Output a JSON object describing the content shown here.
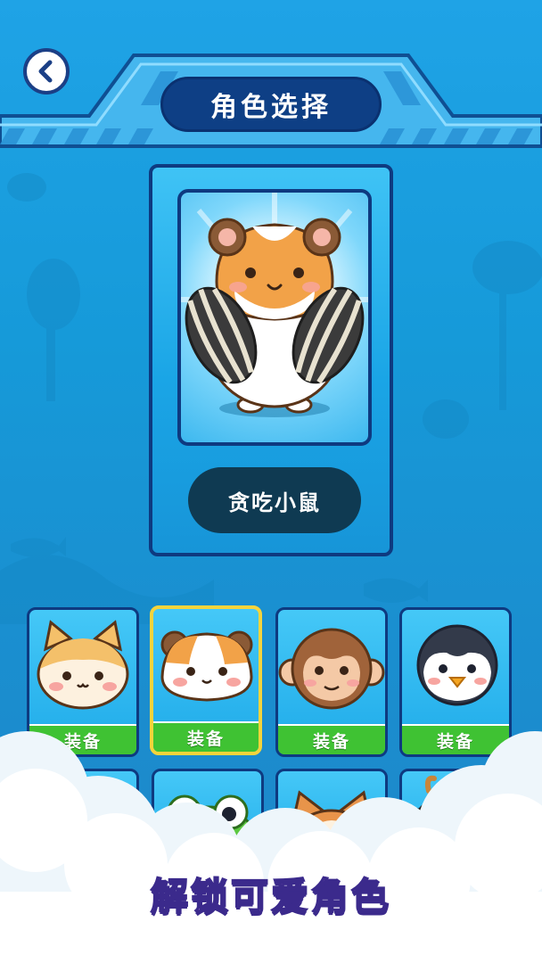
{
  "header": {
    "title": "角色选择",
    "back_icon": "chevron-left-icon"
  },
  "preview": {
    "character_name": "贪吃小鼠",
    "character_icon": "hamster-with-seeds"
  },
  "characters": [
    {
      "id": "cat",
      "icon": "cat-face",
      "button_label": "装备",
      "selected": false
    },
    {
      "id": "hamster",
      "icon": "hamster-face",
      "button_label": "装备",
      "selected": true
    },
    {
      "id": "monkey",
      "icon": "monkey-face",
      "button_label": "装备",
      "selected": false
    },
    {
      "id": "penguin",
      "icon": "penguin-face",
      "button_label": "装备",
      "selected": false
    },
    {
      "id": "panda",
      "icon": "panda-face",
      "selected": false
    },
    {
      "id": "frog",
      "icon": "frog-face",
      "selected": false
    },
    {
      "id": "shiba",
      "icon": "shiba-face",
      "selected": false
    },
    {
      "id": "cow",
      "icon": "cow-face",
      "selected": false
    }
  ],
  "promo": {
    "text": "解锁可爱角色"
  },
  "colors": {
    "equip_green": "#3fc233",
    "selected_border": "#f5d43c",
    "frame_navy": "#0e3a80",
    "title_pill": "#0e3f85",
    "name_pill": "#0f3a52"
  }
}
